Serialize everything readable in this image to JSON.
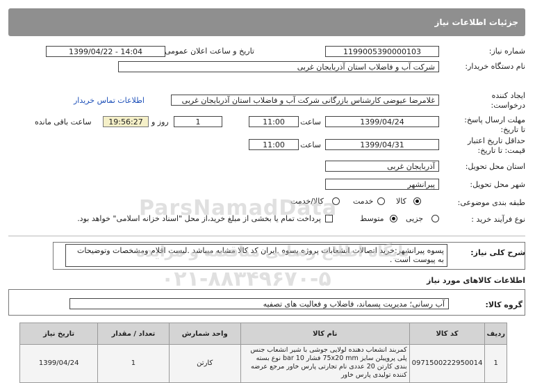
{
  "header": {
    "title": "جزئیات اطلاعات نیاز"
  },
  "fields": {
    "need_number_label": "شماره نیاز:",
    "need_number": "1199005390000103",
    "announce_label": "تاریخ و ساعت اعلان عمومی:",
    "announce_value": "1399/04/22 - 14:04",
    "buyer_label": "نام دستگاه خریدار:",
    "buyer_value": "شرکت آب و فاضلاب استان آذربایجان غربی",
    "creator_label_1": "ایجاد کننده",
    "creator_label_2": "درخواست:",
    "creator_value": "غلامرضا عیوضی کارشناس بازرگانی شرکت آب و فاضلاب استان آذربایجان غربی",
    "contact_link": "اطلاعات تماس خریدار",
    "deadline_label_1": "مهلت ارسال پاسخ:",
    "deadline_label_2": "تا تاریخ:",
    "deadline_date": "1399/04/24",
    "time_label": "ساعت",
    "deadline_time": "11:00",
    "days_value": "1",
    "days_label": "روز و",
    "remaining_time": "19:56:27",
    "remaining_label": "ساعت باقی مانده",
    "validity_label_1": "حداقل تاریخ اعتبار",
    "validity_label_2": "قیمت: تا تاریخ:",
    "validity_date": "1399/04/31",
    "validity_time": "11:00",
    "province_label": "استان محل تحویل:",
    "province_value": "آذربایجان غربی",
    "city_label": "شهر محل تحویل:",
    "city_value": "پیرانشهر",
    "category_label": "طبقه بندی موضوعی:",
    "category_options": [
      "کالا",
      "خدمت",
      "کالا/خدمت"
    ],
    "category_selected": "کالا",
    "process_label": "نوع فرآیند خرید :",
    "process_options": [
      "جزیی",
      "متوسط"
    ],
    "process_selected": "متوسط",
    "payment_note": "پرداخت تمام یا بخشی از مبلغ خرید،از محل \"اسناد خزانه اسلامی\" خواهد بود."
  },
  "description": {
    "label": "شرح کلی نیاز:",
    "text": "پسوه پیرانشهر:خرید اتصالات انشعابات پروژه پسوه  .ایران کد کالا مشابه میباشد .لیست اقلام ومشخصات وتوضیحات به پیوست است ."
  },
  "goods_section": {
    "title": "اطلاعات کالاهای مورد نیاز",
    "group_label": "گروه کالا:",
    "group_value": "آب رسانی؛ مدیریت پسماند، فاضلاب و فعالیت های تصفیه"
  },
  "table": {
    "headers": [
      "ردیف",
      "کد کالا",
      "نام کالا",
      "واحد شمارش",
      "تعداد / مقدار",
      "تاریخ نیاز"
    ],
    "rows": [
      {
        "row": "1",
        "code": "0971500222950014",
        "name": "کمربند انشعاب دهنده لولایی جوشی با شیر انشعاب جنس پلی پروپیلن سایز 75x20 mm فشار 10 bar نوع بسته بندی کارتن 20 عددی نام تجارتی پارس خاور مرجع عرضه کننده تولیدی پارس خاور",
        "unit": "کارتن",
        "qty": "1",
        "date": "1399/04/24"
      }
    ]
  },
  "watermark": {
    "brand": "ParsNamadData",
    "line1": "پایگاه اطلاع رسانی مناقصه و مزایده",
    "phone": "۰۲۱-۸۸۳۴۹۶۷۰-۵"
  }
}
